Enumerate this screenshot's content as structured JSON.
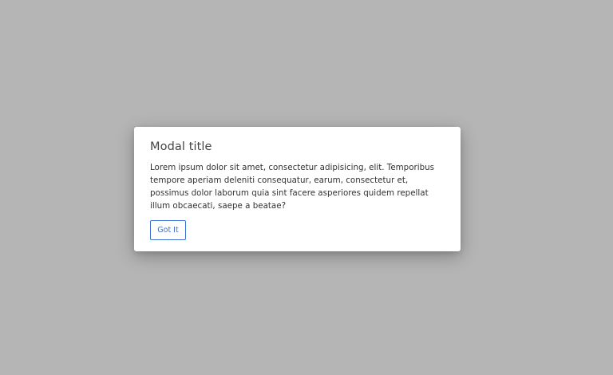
{
  "colors": {
    "backdrop": "#b5b5b5",
    "modal_background": "#ffffff",
    "accent": "#3b6fd1",
    "title_text": "#444444",
    "body_text": "#333333"
  },
  "modal": {
    "title": "Modal title",
    "body": "Lorem ipsum dolor sit amet, consectetur adipisicing, elit. Temporibus tempore aperiam deleniti consequatur, earum, consectetur et, possimus dolor laborum quia sint facere asperiores quidem repellat illum obcaecati, saepe a beatae?",
    "button_label": "Got It"
  }
}
